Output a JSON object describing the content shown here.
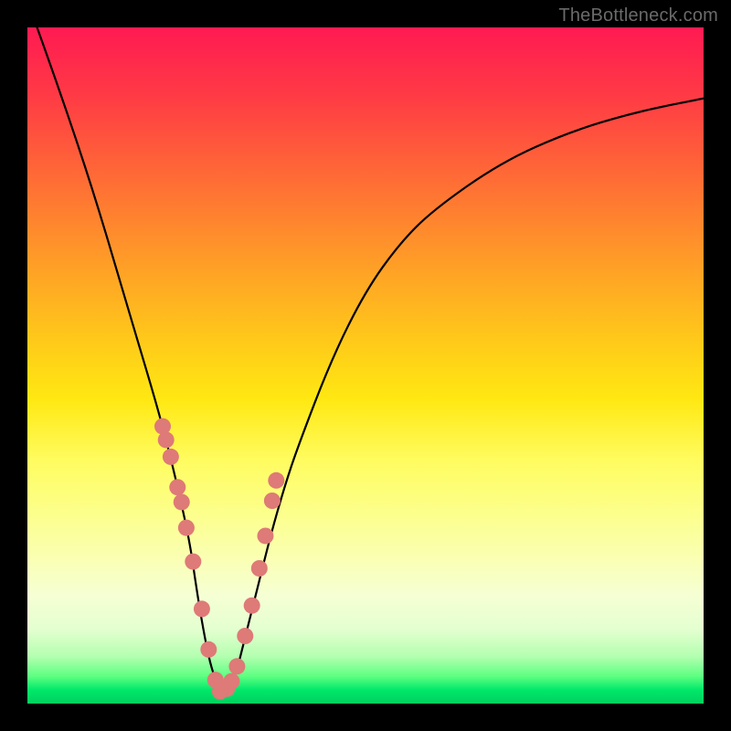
{
  "watermark": "TheBottleneck.com",
  "chart_data": {
    "type": "line",
    "title": "",
    "xlabel": "",
    "ylabel": "",
    "xlim": [
      0,
      1
    ],
    "ylim": [
      0,
      1
    ],
    "x": [
      0.0,
      0.05,
      0.1,
      0.15,
      0.18,
      0.2,
      0.22,
      0.24,
      0.25,
      0.26,
      0.27,
      0.28,
      0.285,
      0.29,
      0.3,
      0.31,
      0.32,
      0.34,
      0.36,
      0.38,
      0.4,
      0.45,
      0.5,
      0.55,
      0.6,
      0.7,
      0.8,
      0.9,
      1.0
    ],
    "y": [
      1.04,
      0.9,
      0.75,
      0.58,
      0.48,
      0.41,
      0.33,
      0.24,
      0.17,
      0.11,
      0.06,
      0.03,
      0.018,
      0.02,
      0.025,
      0.05,
      0.09,
      0.17,
      0.25,
      0.32,
      0.38,
      0.51,
      0.61,
      0.68,
      0.73,
      0.8,
      0.845,
      0.875,
      0.895
    ],
    "series": [
      {
        "name": "highlight-dots",
        "x": [
          0.2,
          0.205,
          0.212,
          0.222,
          0.228,
          0.235,
          0.245,
          0.258,
          0.268,
          0.278,
          0.285,
          0.295,
          0.302,
          0.31,
          0.322,
          0.332,
          0.343,
          0.352,
          0.362,
          0.368
        ],
        "y": [
          0.41,
          0.39,
          0.365,
          0.32,
          0.298,
          0.26,
          0.21,
          0.14,
          0.08,
          0.035,
          0.018,
          0.022,
          0.033,
          0.055,
          0.1,
          0.145,
          0.2,
          0.248,
          0.3,
          0.33
        ]
      }
    ],
    "gradient_stops": [
      {
        "pos": 0.0,
        "color": "#ff1a52"
      },
      {
        "pos": 0.5,
        "color": "#ffe812"
      },
      {
        "pos": 1.0,
        "color": "#00d060"
      }
    ]
  }
}
